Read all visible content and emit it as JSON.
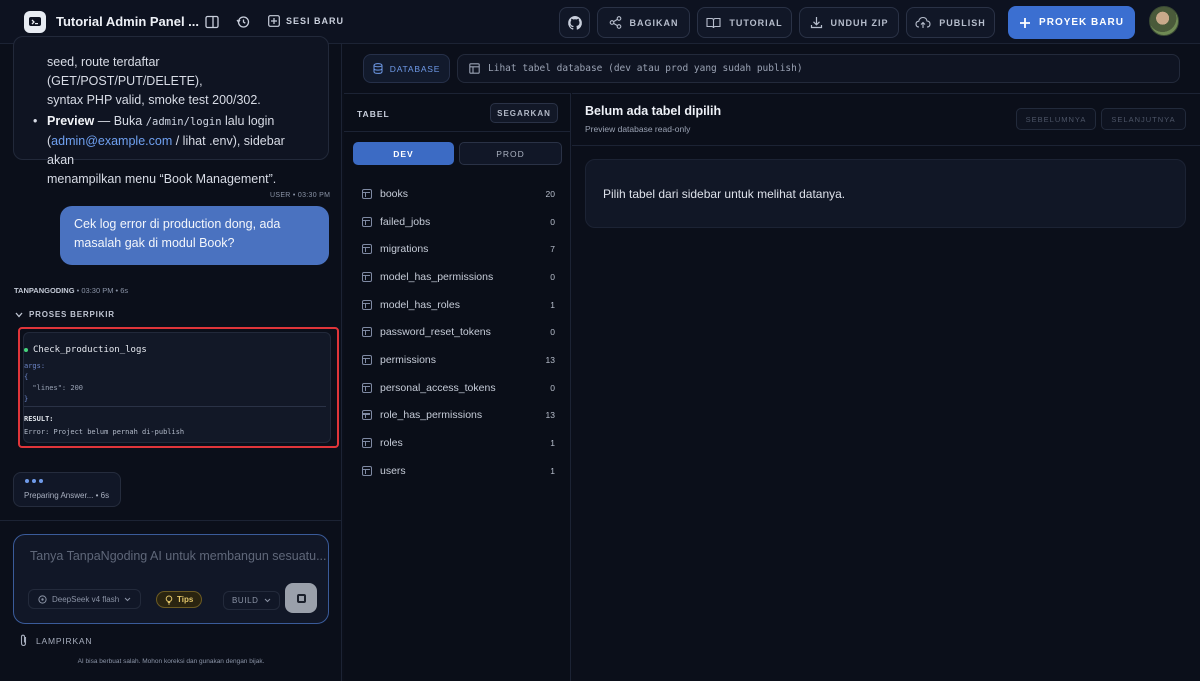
{
  "app": {
    "title": "Tutorial Admin Panel ...",
    "new_session": "SESI BARU"
  },
  "toolbar": {
    "share": "BAGIKAN",
    "tutorial": "TUTORIAL",
    "download": "UNDUH ZIP",
    "publish": "PUBLISH",
    "new_project": "PROYEK BARU"
  },
  "chat": {
    "prev_message": {
      "line1": "seed, route terdaftar (GET/POST/PUT/DELETE),",
      "line2": "syntax PHP valid, smoke test 200/302.",
      "preview_label": "Preview",
      "preview_a": " — Buka ",
      "preview_code": "/admin/login",
      "preview_b": " lalu login",
      "preview_c1": "(",
      "preview_link": "admin@example.com",
      "preview_c2": " / lihat .env), sidebar akan",
      "preview_d": "menampilkan menu “Book Management”."
    },
    "user_meta": "USER • 03:30 PM",
    "user_message": "Cek log error di production dong, ada masalah gak di modul Book?",
    "ai_name": "TANPANGODING",
    "ai_meta": " • 03:30 PM • 6s",
    "thinking_label": "PROSES BERPIKIR",
    "tool": {
      "name": "Check_production_logs",
      "args_label": "args:",
      "args_open": "{",
      "args_line": "  \"lines\": 200",
      "args_close": "}",
      "result_label": "RESULT:",
      "result_text": "Error: Project belum pernah di-publish"
    },
    "preparing": "Preparing Answer... • 6s",
    "input_placeholder": "Tanya TanpaNgoding AI untuk membangun sesuatu...",
    "model": "DeepSeek v4 flash",
    "tips": "Tips",
    "mode": "BUILD",
    "attach": "LAMPIRKAN",
    "disclaimer": "AI bisa berbuat salah. Mohon koreksi dan gunakan dengan bijak."
  },
  "database": {
    "chip": "DATABASE",
    "info": "Lihat tabel database (dev atau prod yang sudah publish)",
    "tables_title": "TABEL",
    "refresh": "SEGARKAN",
    "env_dev": "DEV",
    "env_prod": "PROD",
    "tables": [
      {
        "name": "books",
        "count": "20"
      },
      {
        "name": "failed_jobs",
        "count": "0"
      },
      {
        "name": "migrations",
        "count": "7"
      },
      {
        "name": "model_has_permissions",
        "count": "0"
      },
      {
        "name": "model_has_roles",
        "count": "1"
      },
      {
        "name": "password_reset_tokens",
        "count": "0"
      },
      {
        "name": "permissions",
        "count": "13"
      },
      {
        "name": "personal_access_tokens",
        "count": "0"
      },
      {
        "name": "role_has_permissions",
        "count": "13"
      },
      {
        "name": "roles",
        "count": "1"
      },
      {
        "name": "users",
        "count": "1"
      }
    ],
    "detail_title": "Belum ada tabel dipilih",
    "detail_sub": "Preview database read-only",
    "prev_btn": "SEBELUMNYA",
    "next_btn": "SELANJUTNYA",
    "empty_text": "Pilih tabel dari sidebar untuk melihat datanya."
  },
  "colors": {
    "accent": "#3b6fd1",
    "highlight_border": "#e0353a",
    "status_green": "#46d37c"
  }
}
